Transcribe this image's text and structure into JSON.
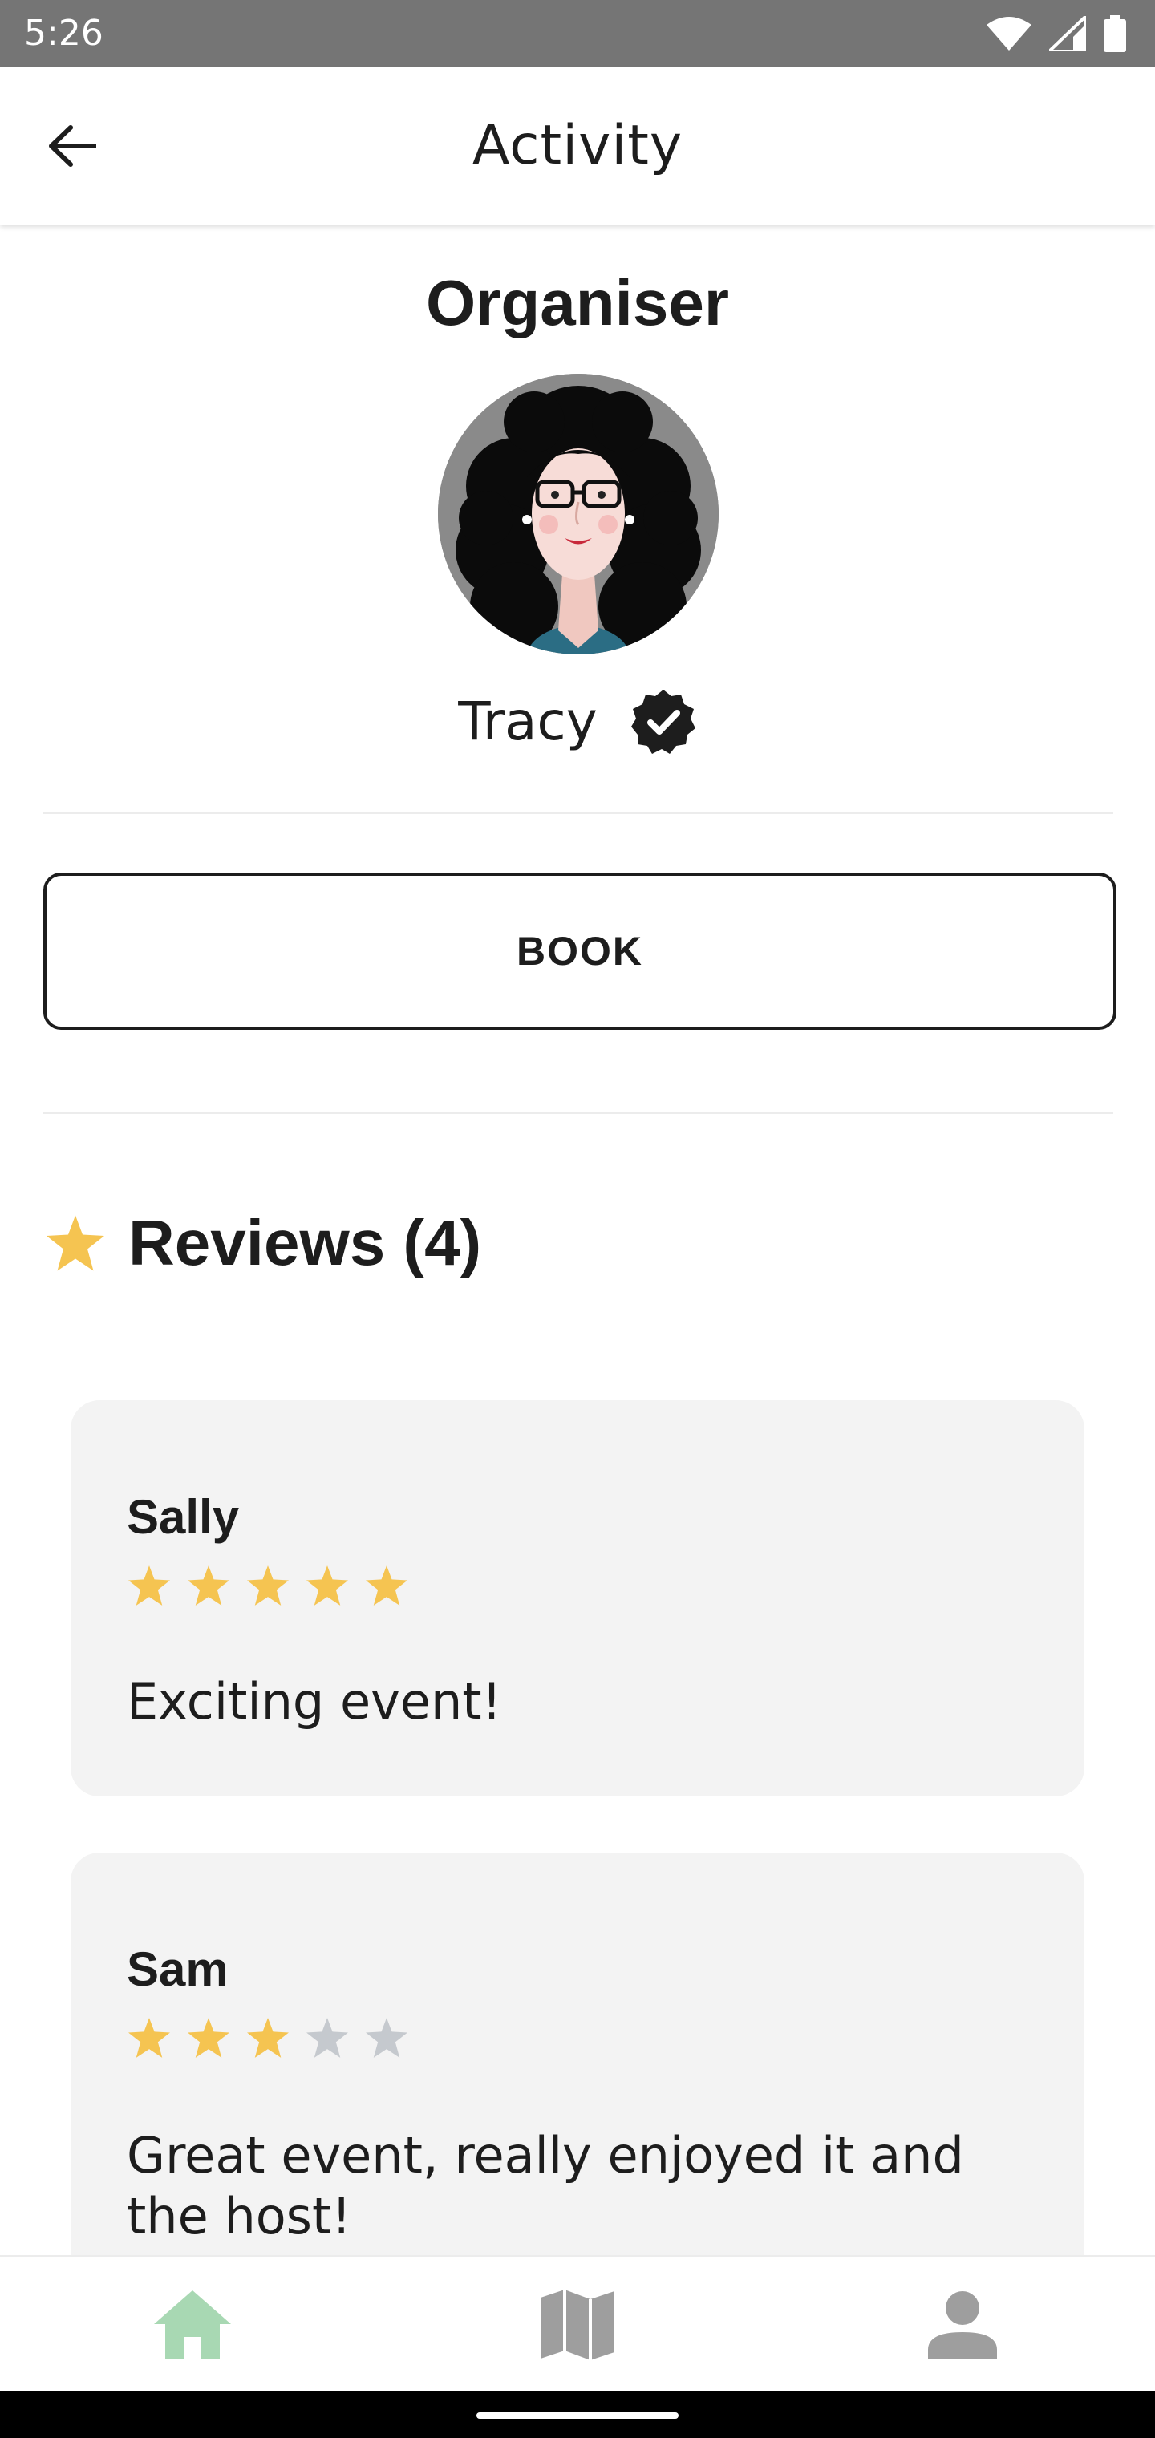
{
  "status_bar": {
    "time": "5:26",
    "icons": [
      "wifi-icon",
      "cellular-signal-icon",
      "battery-icon"
    ]
  },
  "app_bar": {
    "title": "Activity",
    "back_icon": "arrow-left-icon"
  },
  "organiser": {
    "heading": "Organiser",
    "name": "Tracy",
    "verified_icon": "verified-badge-icon"
  },
  "book_button": {
    "label": "BOOK"
  },
  "reviews": {
    "title": "Reviews (4)",
    "items": [
      {
        "author": "Sally",
        "rating": 5,
        "max_rating": 5,
        "text": "Exciting event!"
      },
      {
        "author": "Sam",
        "rating": 3,
        "max_rating": 5,
        "text": "Great event, really enjoyed it and the host!"
      }
    ]
  },
  "bottom_nav": {
    "items": [
      {
        "icon": "home-icon",
        "active": true
      },
      {
        "icon": "map-icon",
        "active": false
      },
      {
        "icon": "profile-icon",
        "active": false
      }
    ]
  },
  "colors": {
    "star_filled": "#F5C451",
    "star_empty": "#C5C9CE",
    "nav_active": "#A8D8B3",
    "nav_inactive": "#9E9E9E",
    "card_background": "#F3F3F3",
    "status_bar": "#757575"
  }
}
